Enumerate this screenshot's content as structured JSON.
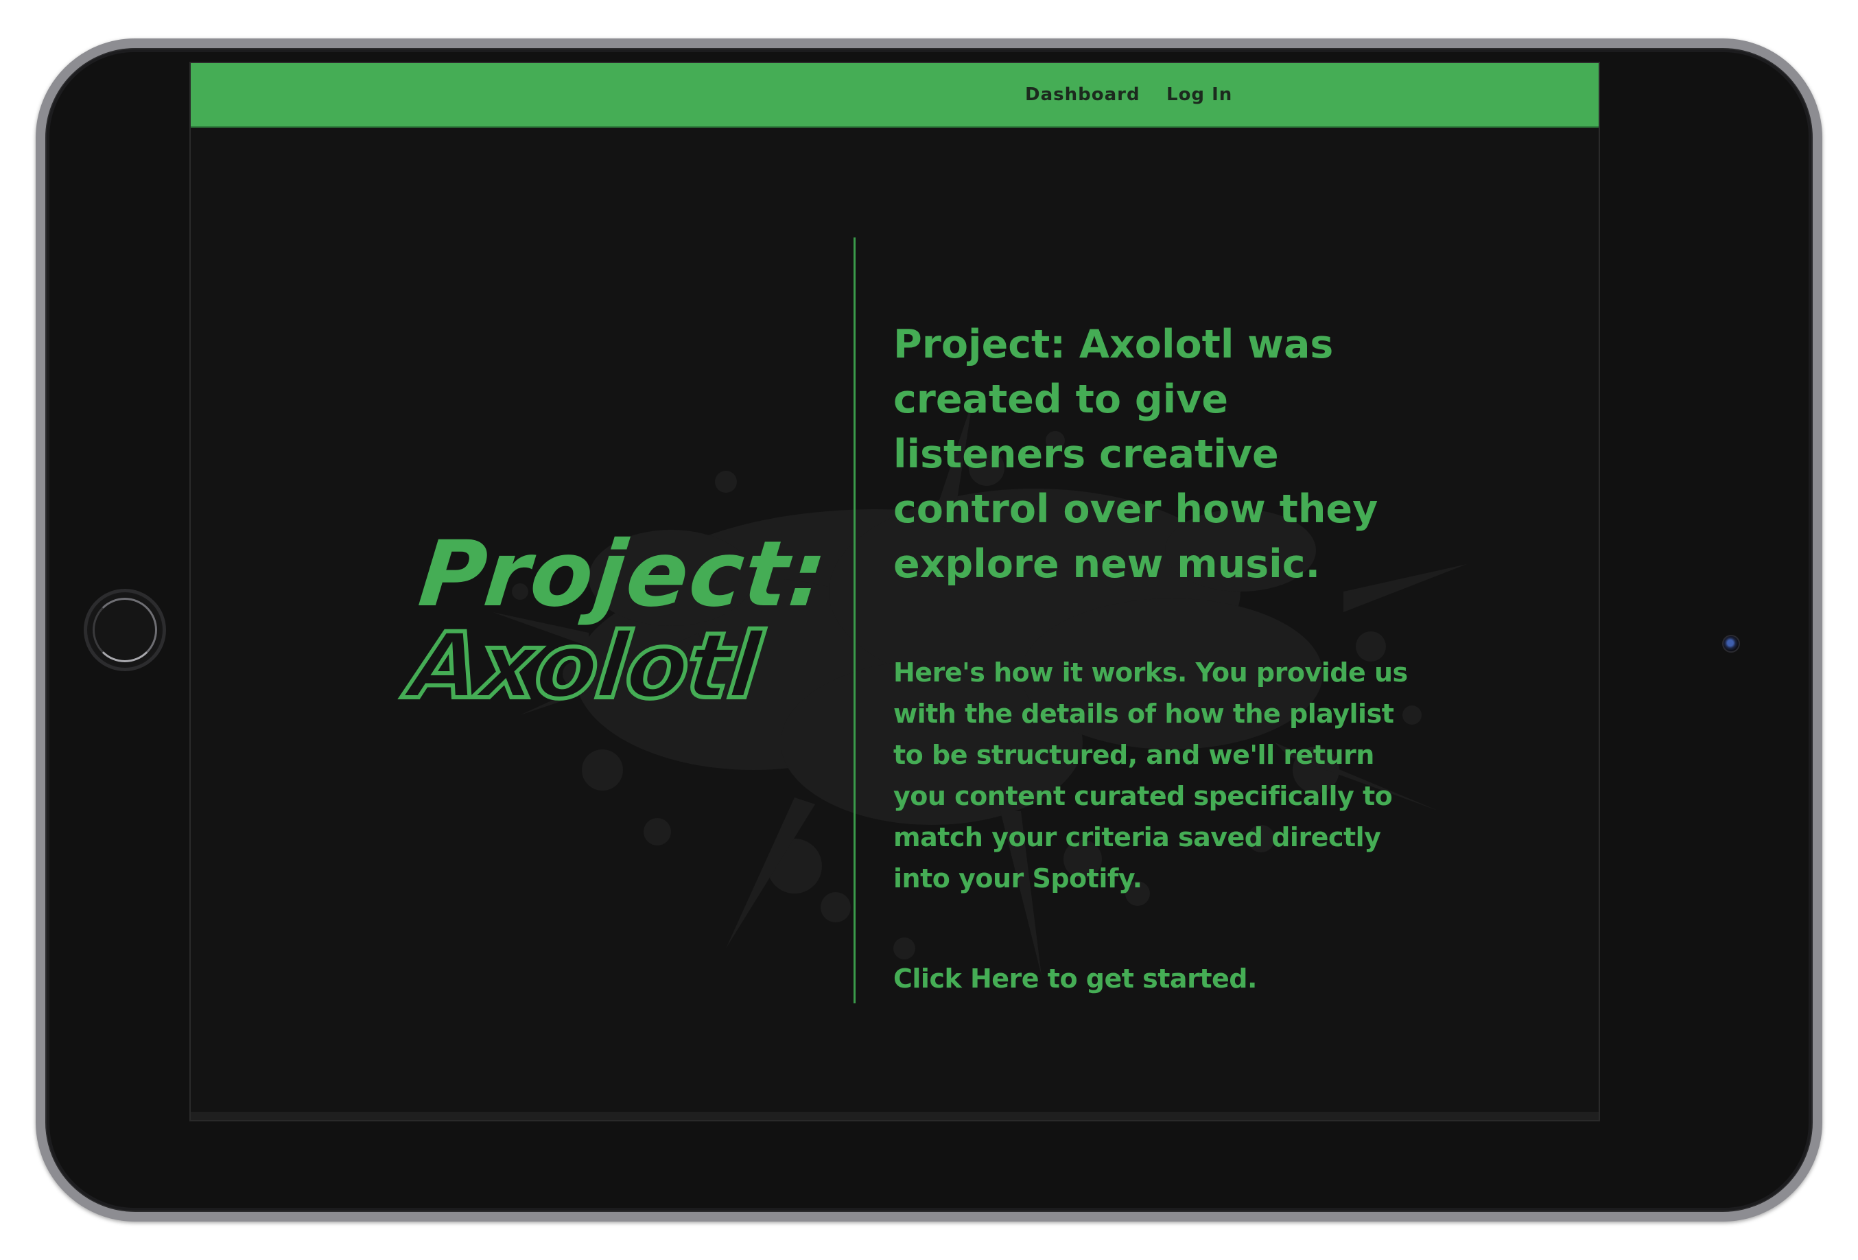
{
  "navbar": {
    "links": [
      {
        "label": "Dashboard"
      },
      {
        "label": "Log In"
      }
    ],
    "color": "#45ad55"
  },
  "hero": {
    "logo_line1": "Project:",
    "logo_line2": "Axolotl",
    "headline": "Project: Axolotl was created to give listeners creative control over how they explore new music.",
    "body": "Here's how it works. You provide us with the details of how the playlist to be structured, and we'll return you content curated specifically to match your criteria saved directly into your Spotify.",
    "cta": "Click Here to get started."
  },
  "theme": {
    "accent": "#45ad55",
    "background": "#131313"
  }
}
